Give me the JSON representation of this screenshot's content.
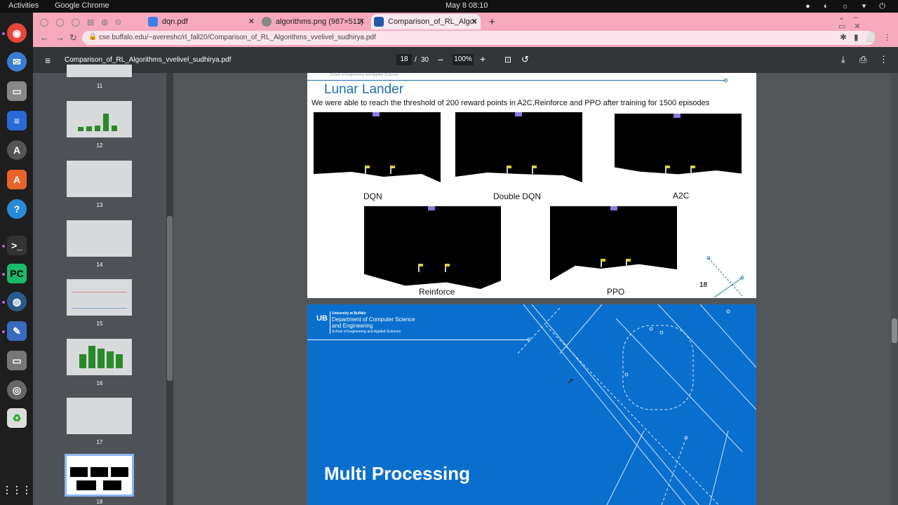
{
  "os": {
    "activities": "Activities",
    "app_name": "Google Chrome",
    "clock": "May 8  08:10"
  },
  "browser": {
    "tabs": [
      {
        "label": "dqn.pdf",
        "icon": "pdf-icon",
        "icon_color": "#3d7ef0"
      },
      {
        "label": "algorithms.png (987×511)",
        "icon": "globe-icon",
        "icon_color": "#888"
      },
      {
        "label": "Comparison_of_RL_Algor",
        "icon": "ub-icon",
        "icon_color": "#1e5aa8"
      }
    ],
    "new_tab": "+",
    "url": "cse.buffalo.edu/~avereshc/rl_fall20/Comparison_of_RL_Algorithms_vvelivel_sudhirya.pdf"
  },
  "pdf": {
    "filename": "Comparison_of_RL_Algorithms_vvelivel_sudhirya.pdf",
    "page_current": "18",
    "page_sep": "/",
    "page_total": "30",
    "zoom": "100%"
  },
  "thumbs": [
    "11",
    "12",
    "13",
    "14",
    "15",
    "16",
    "17",
    "18"
  ],
  "slide18": {
    "header_sub": "School of Engineering and Applied Sciences",
    "title": "Lunar Lander",
    "subtitle": "We were able to reach the threshold of 200 reward points in A2C,Reinforce and PPO after training for 1500  episodes",
    "labels": [
      "DQN",
      "Double DQN",
      "A2C",
      "Reinforce",
      "PPO"
    ],
    "page_number": "18"
  },
  "slide19": {
    "univ": "University at Buffalo",
    "dept": "Department of Computer Science",
    "dept2": "and Engineering",
    "school": "School of Engineering and Applied Sciences",
    "title": "Multi Processing"
  },
  "colors": {
    "accent": "#1a6fb3",
    "slide_blue": "#0a6fcc",
    "chrome_pink": "#f6a9bc"
  }
}
